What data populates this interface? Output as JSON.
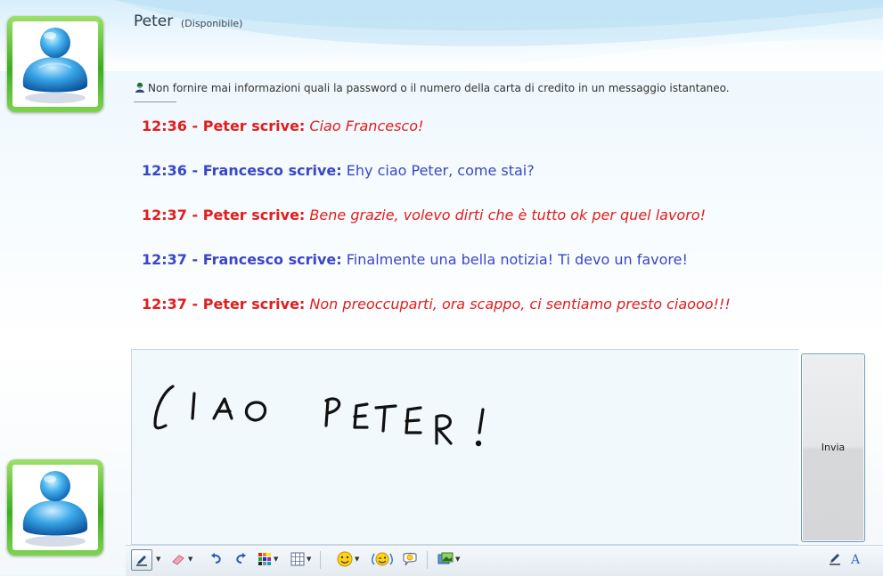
{
  "header": {
    "contact_name": "Peter",
    "contact_status": "(Disponibile)"
  },
  "warning": {
    "icon": "security-person-icon",
    "text": "Non fornire mai informazioni quali la password o il numero della carta di credito in un messaggio istantaneo."
  },
  "messages": [
    {
      "time": "12:36",
      "sender": "Peter scrive:",
      "text": "Ciao Francesco!",
      "color": "#e21d1d"
    },
    {
      "time": "12:36",
      "sender": "Francesco scrive:",
      "text": "Ehy ciao Peter, come stai?",
      "color": "#3a46c8"
    },
    {
      "time": "12:37",
      "sender": "Peter scrive:",
      "text": "Bene grazie, volevo dirti che è tutto ok per quel lavoro!",
      "color": "#e21d1d"
    },
    {
      "time": "12:37",
      "sender": "Francesco scrive:",
      "text": "Finalmente una bella notizia! Ti devo un favore!",
      "color": "#3a46c8"
    },
    {
      "time": "12:37",
      "sender": "Peter scrive:",
      "text": "Non preoccuparti, ora scappo, ci sentiamo presto ciaooo!!!",
      "color": "#e21d1d"
    }
  ],
  "compose": {
    "handwriting_text": "CIAO PETER!",
    "send_label": "Invia"
  },
  "toolbar": {
    "items": [
      "pen-icon",
      "eraser-icon",
      "undo-icon",
      "redo-icon",
      "color-palette-icon",
      "grid-icon",
      "emoticon-icon",
      "wink-icon",
      "nudge-icon",
      "background-icon",
      "handwriting-mode-icon",
      "text-mode-icon"
    ]
  },
  "colors": {
    "peter": "#e21d1d",
    "francesco": "#3a46c8",
    "avatar_frame": "#3cae1e"
  }
}
